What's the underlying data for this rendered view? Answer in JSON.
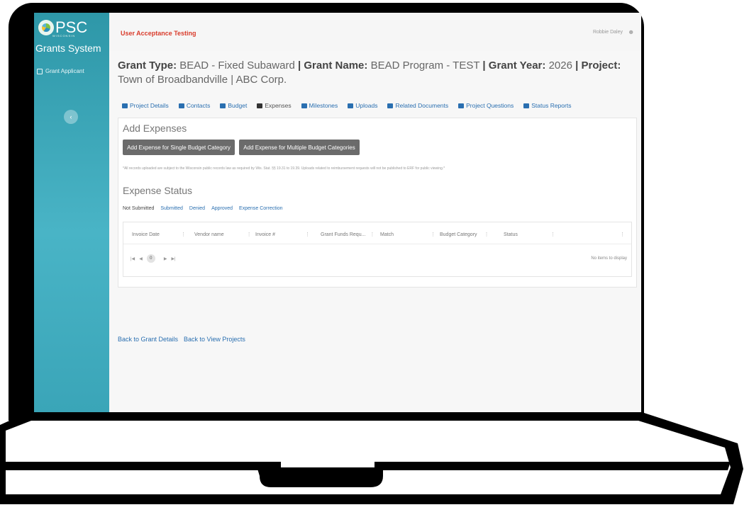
{
  "sidebar": {
    "logo_text": "PSC",
    "logo_sub": "WISCONSIN",
    "app_title": "Grants System",
    "items": [
      {
        "label": "Grant Applicant"
      }
    ]
  },
  "topbar": {
    "env_label": "User Acceptance Testing",
    "user_name": "Robbie Daley"
  },
  "grant": {
    "type_label": "Grant Type:",
    "type_value": "BEAD - Fixed Subaward",
    "name_label": "Grant Name:",
    "name_value": "BEAD Program - TEST",
    "year_label": "Grant Year:",
    "year_value": "2026",
    "project_label": "Project:",
    "project_value": "Town of Broadbandville | ABC Corp."
  },
  "tabs": [
    {
      "label": "Project Details"
    },
    {
      "label": "Contacts"
    },
    {
      "label": "Budget"
    },
    {
      "label": "Expenses"
    },
    {
      "label": "Milestones"
    },
    {
      "label": "Uploads"
    },
    {
      "label": "Related Documents"
    },
    {
      "label": "Project Questions"
    },
    {
      "label": "Status Reports"
    }
  ],
  "add_expenses": {
    "title": "Add Expenses",
    "btn_single": "Add Expense for Single Budget Category",
    "btn_multi": "Add Expense for Multiple Budget Categories",
    "note": "*All records uploaded are subject to the Wisconsin public records law as required by Wis. Stat. §§ 19.31 to 19.39. Uploads related to reimbursement requests will not be published to ERF for public viewing.*"
  },
  "expense_status": {
    "title": "Expense Status",
    "tabs": [
      {
        "label": "Not Submitted"
      },
      {
        "label": "Submitted"
      },
      {
        "label": "Denied"
      },
      {
        "label": "Approved"
      },
      {
        "label": "Expense Correction"
      }
    ],
    "columns": [
      {
        "label": "Invoice Date"
      },
      {
        "label": "Vendor name"
      },
      {
        "label": "Invoice #"
      },
      {
        "label": "Grant Funds Requ..."
      },
      {
        "label": "Match"
      },
      {
        "label": "Budget Category"
      },
      {
        "label": "Status"
      }
    ],
    "pager_page": "0",
    "no_items": "No items to display"
  },
  "links": {
    "back_grant": "Back to Grant Details",
    "back_projects": "Back to View Projects"
  }
}
